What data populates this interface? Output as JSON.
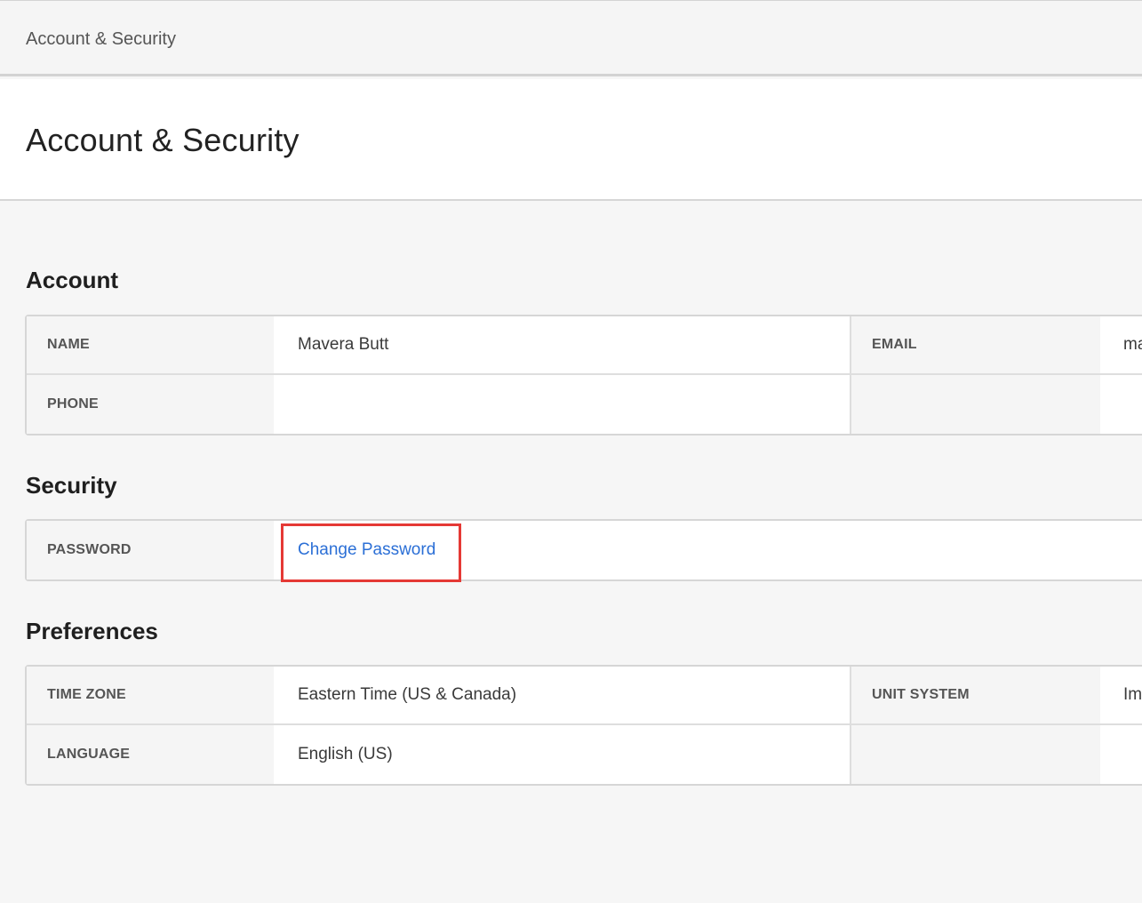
{
  "breadcrumb": "Account & Security",
  "page_title": "Account & Security",
  "sections": {
    "account": {
      "title": "Account",
      "name_label": "NAME",
      "name_value": "Mavera Butt",
      "email_label": "EMAIL",
      "email_value": "ma",
      "phone_label": "PHONE",
      "phone_value": ""
    },
    "security": {
      "title": "Security",
      "password_label": "PASSWORD",
      "change_password_link": "Change Password"
    },
    "preferences": {
      "title": "Preferences",
      "time_zone_label": "TIME ZONE",
      "time_zone_value": "Eastern Time (US & Canada)",
      "unit_system_label": "UNIT SYSTEM",
      "unit_system_value": "Imp",
      "language_label": "LANGUAGE",
      "language_value": "English (US)"
    }
  },
  "colors": {
    "link": "#2b6fd6",
    "highlight": "#e53935",
    "label_bg": "#f5f5f5",
    "page_bg": "#f6f6f6"
  }
}
